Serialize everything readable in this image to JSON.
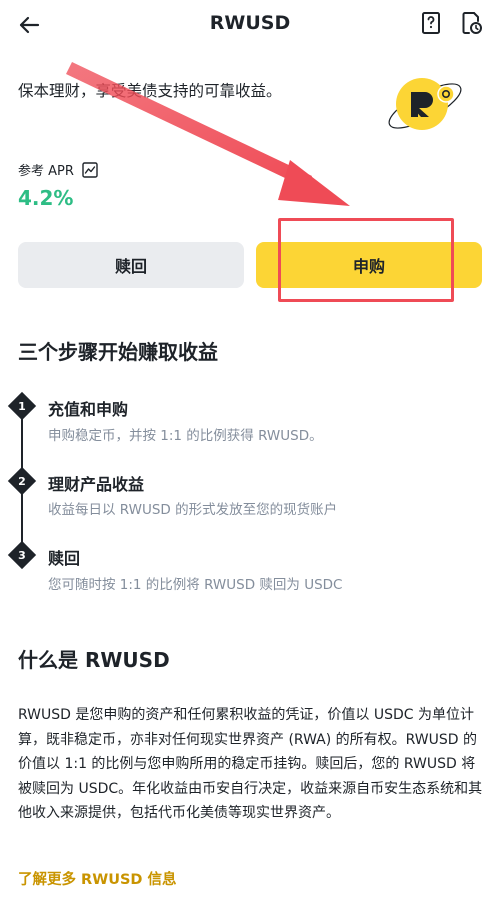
{
  "header": {
    "title": "RWUSD"
  },
  "intro": {
    "text": "保本理财，享受美债支持的可靠收益。"
  },
  "apr": {
    "label": "参考 APR",
    "value": "4.2%"
  },
  "buttons": {
    "redeem": "赎回",
    "subscribe": "申购"
  },
  "steps": {
    "title": "三个步骤开始赚取收益",
    "items": [
      {
        "num": "1",
        "title": "充值和申购",
        "desc": "申购稳定币，并按 1:1 的比例获得 RWUSD。"
      },
      {
        "num": "2",
        "title": "理财产品收益",
        "desc": "收益每日以 RWUSD 的形式发放至您的现货账户"
      },
      {
        "num": "3",
        "title": "赎回",
        "desc": "您可随时按 1:1 的比例将 RWUSD 赎回为 USDC"
      }
    ]
  },
  "what": {
    "title": "什么是 RWUSD",
    "body": "RWUSD 是您申购的资产和任何累积收益的凭证，价值以 USDC 为单位计算，既非稳定币，亦非对任何现实世界资产 (RWA) 的所有权。RWUSD 的价值以 1:1 的比例与您申购所用的稳定币挂钩。赎回后，您的 RWUSD 将被赎回为 USDC。年化收益由币安自行决定，收益来源自币安生态系统和其他收入来源提供，包括代币化美债等现实世界资产。",
    "learn_more": "了解更多 RWUSD 信息"
  },
  "colors": {
    "accent": "#fcd535",
    "positive": "#2ebd85",
    "link": "#c99400",
    "annotation": "#ef4b56"
  }
}
